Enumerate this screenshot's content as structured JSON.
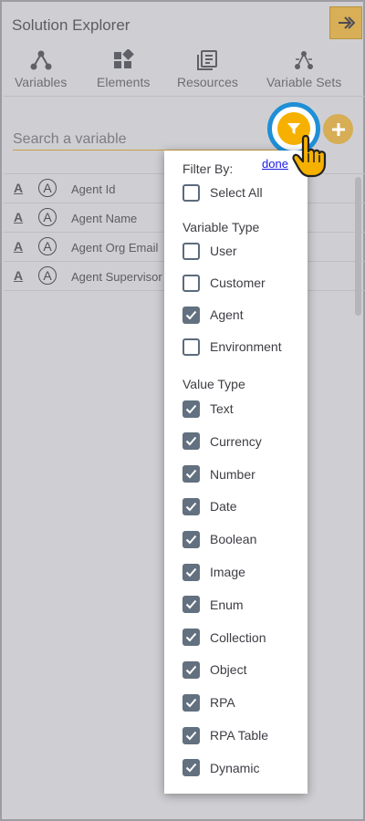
{
  "header": {
    "title": "Solution Explorer",
    "collapse_icon": "double-arrow-right-icon"
  },
  "tabs": [
    {
      "label": "Variables",
      "icon": "variables-icon"
    },
    {
      "label": "Elements",
      "icon": "elements-icon"
    },
    {
      "label": "Resources",
      "icon": "resources-icon"
    },
    {
      "label": "Variable Sets",
      "icon": "variable-sets-icon"
    }
  ],
  "search": {
    "placeholder": "Search a variable",
    "value": ""
  },
  "variables": [
    {
      "type_glyph": "A",
      "badge_glyph": "A",
      "label": "Agent Id"
    },
    {
      "type_glyph": "A",
      "badge_glyph": "A",
      "label": "Agent Name"
    },
    {
      "type_glyph": "A",
      "badge_glyph": "A",
      "label": "Agent Org Email"
    },
    {
      "type_glyph": "A",
      "badge_glyph": "A",
      "label": "Agent Supervisor"
    }
  ],
  "filter": {
    "done_label": "done",
    "filter_by_label": "Filter By:",
    "select_all": {
      "label": "Select All",
      "checked": false
    },
    "variable_type_heading": "Variable Type",
    "variable_types": [
      {
        "label": "User",
        "checked": false
      },
      {
        "label": "Customer",
        "checked": false
      },
      {
        "label": "Agent",
        "checked": true
      },
      {
        "label": "Environment",
        "checked": false
      }
    ],
    "value_type_heading": "Value Type",
    "value_types": [
      {
        "label": "Text",
        "checked": true
      },
      {
        "label": "Currency",
        "checked": true
      },
      {
        "label": "Number",
        "checked": true
      },
      {
        "label": "Date",
        "checked": true
      },
      {
        "label": "Boolean",
        "checked": true
      },
      {
        "label": "Image",
        "checked": true
      },
      {
        "label": "Enum",
        "checked": true
      },
      {
        "label": "Collection",
        "checked": true
      },
      {
        "label": "Object",
        "checked": true
      },
      {
        "label": "RPA",
        "checked": true
      },
      {
        "label": "RPA Table",
        "checked": true
      },
      {
        "label": "Dynamic",
        "checked": true
      }
    ]
  },
  "colors": {
    "panel_bg": "#cfcfd3",
    "accent_gold": "#d8ae56",
    "filter_yellow": "#f6b100",
    "highlight_ring": "#1f8fd6",
    "checkbox_checked": "#62707f",
    "link": "#1a1ae6"
  }
}
